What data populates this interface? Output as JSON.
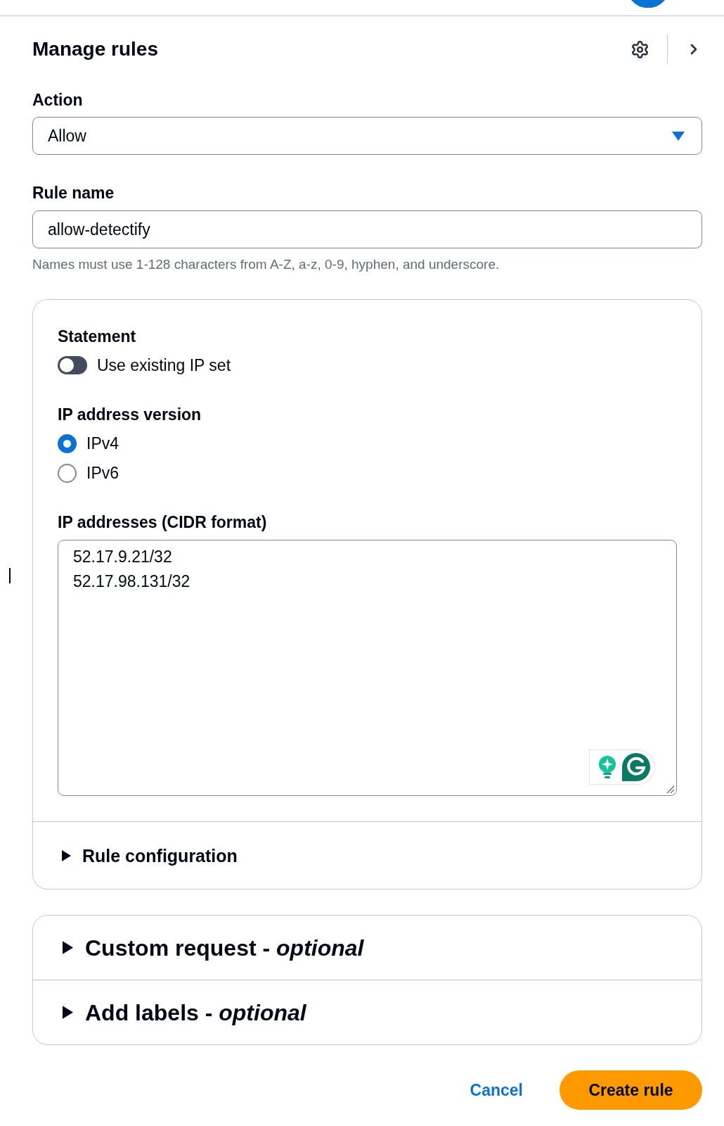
{
  "panel": {
    "title": "Manage rules"
  },
  "action": {
    "label": "Action",
    "value": "Allow"
  },
  "rule_name": {
    "label": "Rule name",
    "value": "allow-detectify",
    "hint": "Names must use 1-128 characters from A-Z, a-z, 0-9, hyphen, and underscore."
  },
  "statement": {
    "title": "Statement",
    "use_existing_ip_set": {
      "label": "Use existing IP set",
      "on": false
    },
    "ip_address_version": {
      "label": "IP address version",
      "options": [
        {
          "label": "IPv4",
          "selected": true
        },
        {
          "label": "IPv6",
          "selected": false
        }
      ]
    },
    "ip_addresses": {
      "label": "IP addresses (CIDR format)",
      "lines": [
        "52.17.9.21/32",
        "52.17.98.131/32"
      ]
    },
    "rule_configuration": {
      "label": "Rule configuration",
      "expanded": false
    }
  },
  "optional_sections": [
    {
      "label": "Custom request - *optional*",
      "expanded": false
    },
    {
      "label": "Add labels - *optional*",
      "expanded": false
    }
  ],
  "footer": {
    "cancel": "Cancel",
    "submit": "Create rule"
  }
}
